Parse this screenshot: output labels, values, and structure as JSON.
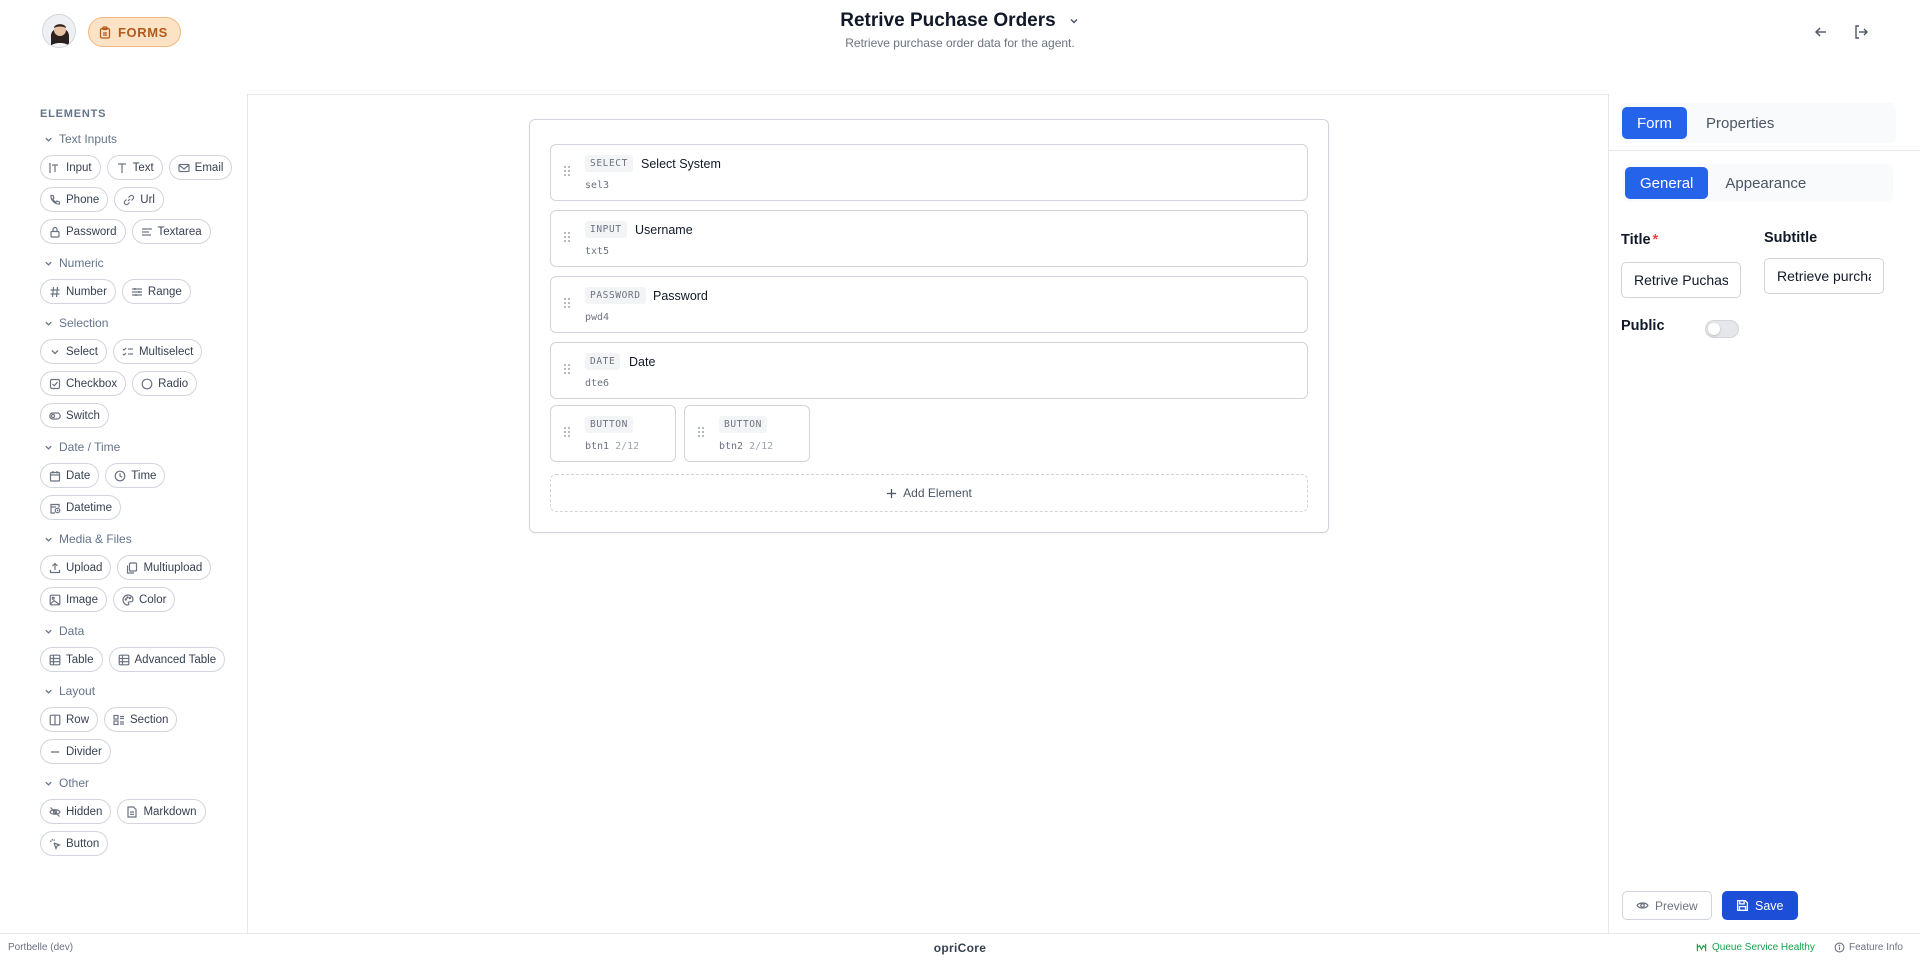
{
  "header": {
    "app_badge": "FORMS",
    "title": "Retrive Puchase Orders",
    "subtitle": "Retrieve purchase order data for the agent.",
    "icons": [
      "avatar",
      "clipboard-icon",
      "chevron-down-icon",
      "arrow-left-icon",
      "logout-icon"
    ]
  },
  "sidebar": {
    "title": "ELEMENTS",
    "groups": [
      {
        "name": "Text Inputs",
        "items": [
          "Input",
          "Text",
          "Email",
          "Phone",
          "Url",
          "Password",
          "Textarea"
        ]
      },
      {
        "name": "Numeric",
        "items": [
          "Number",
          "Range"
        ]
      },
      {
        "name": "Selection",
        "items": [
          "Select",
          "Multiselect",
          "Checkbox",
          "Radio",
          "Switch"
        ]
      },
      {
        "name": "Date / Time",
        "items": [
          "Date",
          "Time",
          "Datetime"
        ]
      },
      {
        "name": "Media & Files",
        "items": [
          "Upload",
          "Multiupload",
          "Image",
          "Color"
        ]
      },
      {
        "name": "Data",
        "items": [
          "Table",
          "Advanced Table"
        ]
      },
      {
        "name": "Layout",
        "items": [
          "Row",
          "Section",
          "Divider"
        ]
      },
      {
        "name": "Other",
        "items": [
          "Hidden",
          "Markdown",
          "Button"
        ]
      }
    ]
  },
  "canvas": {
    "elements": [
      {
        "type": "SELECT",
        "label": "Select System",
        "id": "sel3"
      },
      {
        "type": "INPUT",
        "label": "Username",
        "id": "txt5"
      },
      {
        "type": "PASSWORD",
        "label": "Password",
        "id": "pwd4"
      },
      {
        "type": "DATE",
        "label": "Date",
        "id": "dte6"
      }
    ],
    "buttons": [
      {
        "type": "BUTTON",
        "id": "btn1",
        "span": "2/12"
      },
      {
        "type": "BUTTON",
        "id": "btn2",
        "span": "2/12"
      }
    ],
    "add_element": "Add Element"
  },
  "panel": {
    "tabs": [
      "Form",
      "Properties"
    ],
    "subtabs": [
      "General",
      "Appearance"
    ],
    "title_label": "Title",
    "title_required": "*",
    "title_value": "Retrive Puchase Orders",
    "subtitle_label": "Subtitle",
    "subtitle_value": "Retrieve purchase order data for the agent.",
    "public_label": "Public",
    "public_on": false,
    "preview_label": "Preview",
    "save_label": "Save"
  },
  "footer": {
    "left": "Portbelle (dev)",
    "brand": "opriCore",
    "status": "Queue Service Healthy",
    "info": "Feature Info"
  },
  "colors": {
    "accent": "#2563eb",
    "badge_bg": "#fde3c6",
    "badge_text": "#b45a1a",
    "healthy": "#16a34a",
    "required": "#ef4444"
  }
}
